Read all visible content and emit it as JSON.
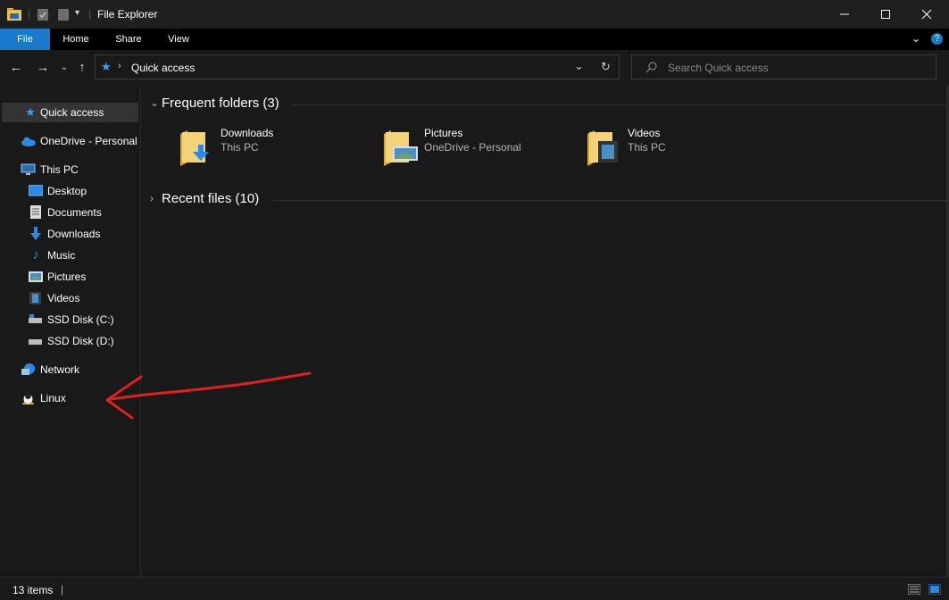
{
  "window": {
    "title": "File Explorer"
  },
  "ribbon": {
    "tabs": [
      "File",
      "Home",
      "Share",
      "View"
    ]
  },
  "address": {
    "path": "Quick access"
  },
  "search": {
    "placeholder": "Search Quick access"
  },
  "sidebar": {
    "items": [
      {
        "label": "Quick access",
        "icon": "star-icon"
      },
      {
        "label": "OneDrive - Personal",
        "icon": "cloud-icon"
      },
      {
        "label": "This PC",
        "icon": "computer-icon"
      },
      {
        "label": "Desktop",
        "icon": "desktop-icon"
      },
      {
        "label": "Documents",
        "icon": "document-icon"
      },
      {
        "label": "Downloads",
        "icon": "download-icon"
      },
      {
        "label": "Music",
        "icon": "music-icon"
      },
      {
        "label": "Pictures",
        "icon": "pictures-icon"
      },
      {
        "label": "Videos",
        "icon": "video-icon"
      },
      {
        "label": "SSD Disk (C:)",
        "icon": "drive-icon"
      },
      {
        "label": "SSD Disk (D:)",
        "icon": "drive-icon"
      },
      {
        "label": "Network",
        "icon": "network-icon"
      },
      {
        "label": "Linux",
        "icon": "linux-penguin-icon"
      }
    ]
  },
  "main": {
    "frequent_label": "Frequent folders (3)",
    "recent_label": "Recent files (10)",
    "folders": [
      {
        "name": "Downloads",
        "location": "This PC"
      },
      {
        "name": "Pictures",
        "location": "OneDrive - Personal"
      },
      {
        "name": "Videos",
        "location": "This PC"
      }
    ]
  },
  "status": {
    "item_count": "13 items"
  },
  "colors": {
    "accent": "#1979ca",
    "background": "#191919",
    "annotation": "#e02020"
  }
}
